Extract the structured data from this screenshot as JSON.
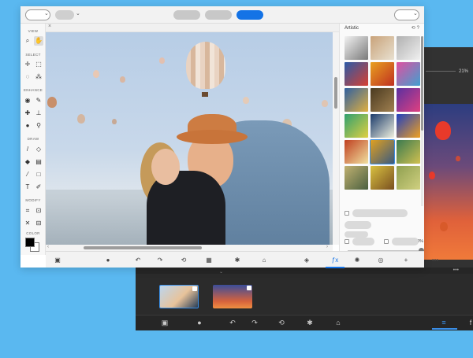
{
  "dark_window": {
    "opacity_value": "21%",
    "toolbar_more": "•••"
  },
  "main_window": {
    "toolpanel": {
      "sections": [
        "VIEW",
        "SELECT",
        "ENHANCE",
        "DRAW",
        "MODIFY",
        "COLOR"
      ]
    },
    "right_panel": {
      "title": "Artistic",
      "strength_value": "100%"
    },
    "bottom_toolbar": {
      "more": "•••"
    }
  },
  "colors": {
    "accent": "#1473e6",
    "background": "#5ab8f0",
    "foreground_color": "#000000",
    "background_color": "#ffffff"
  }
}
